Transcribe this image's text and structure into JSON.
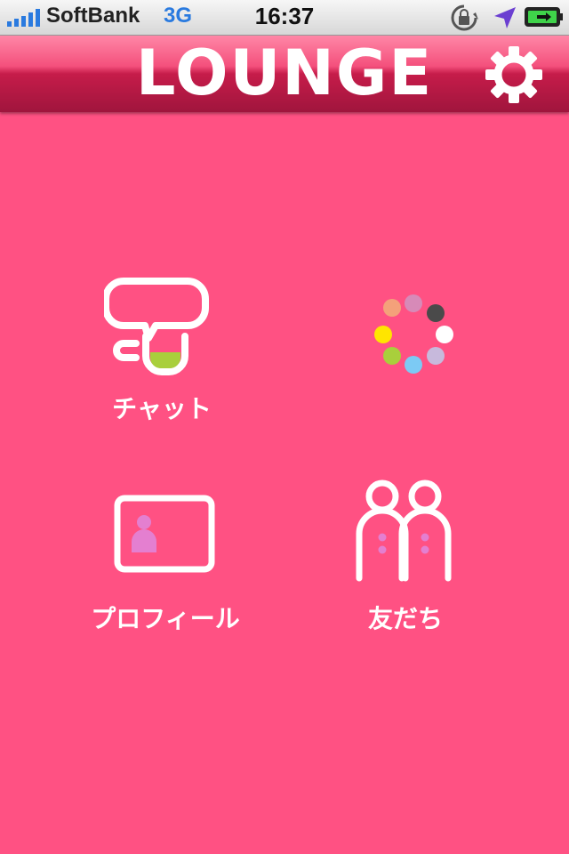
{
  "status_bar": {
    "carrier": "SoftBank",
    "network": "3G",
    "time": "16:37",
    "icons": [
      "signal-icon",
      "rotation-lock-icon",
      "location-icon",
      "battery-charging-icon"
    ]
  },
  "header": {
    "title": "LOUNGE",
    "settings_icon": "gear-icon"
  },
  "menu": {
    "chat": {
      "label": "チャット",
      "icon": "chat-cup-icon"
    },
    "loading": {
      "icon": "loading-spinner-icon"
    },
    "profile": {
      "label": "プロフィール",
      "icon": "profile-card-icon"
    },
    "friends": {
      "label": "友だち",
      "icon": "friends-icon"
    }
  },
  "colors": {
    "background": "#ff5183",
    "header_dark": "#a0153d",
    "header_light": "#ff87a7",
    "chat_cup_fill": "#a9cf3c",
    "profile_person": "#e47fd0",
    "network_text": "#2a7adf"
  }
}
